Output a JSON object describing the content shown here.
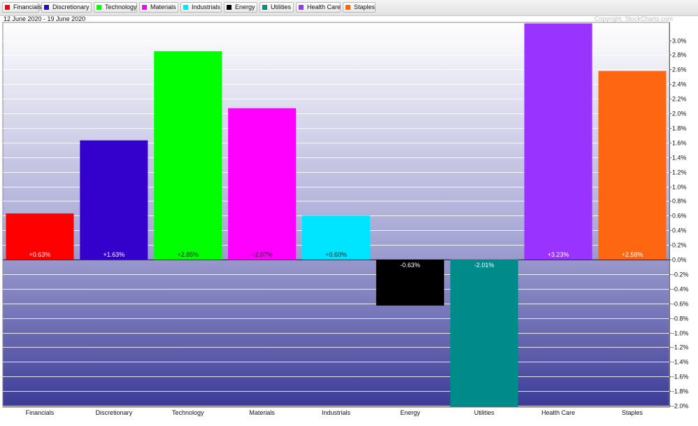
{
  "legend": [
    {
      "label": "Financials",
      "color": "#ff0000"
    },
    {
      "label": "Discretionary",
      "color": "#3300cc"
    },
    {
      "label": "Technology",
      "color": "#00ff00"
    },
    {
      "label": "Materials",
      "color": "#ff00ff"
    },
    {
      "label": "Industrials",
      "color": "#00e5ff"
    },
    {
      "label": "Energy",
      "color": "#000000"
    },
    {
      "label": "Utilities",
      "color": "#008b8b"
    },
    {
      "label": "Health Care",
      "color": "#9933ff"
    },
    {
      "label": "Staples",
      "color": "#ff6611"
    }
  ],
  "date_range": "12 June 2020 - 19 June 2020",
  "copyright": "Copyright, StockCharts.com",
  "chart_data": {
    "type": "bar",
    "categories": [
      "Financials",
      "Discretionary",
      "Technology",
      "Materials",
      "Industrials",
      "Energy",
      "Utilities",
      "Health Care",
      "Staples"
    ],
    "values": [
      0.63,
      1.63,
      2.85,
      2.07,
      0.6,
      -0.63,
      -2.01,
      3.23,
      2.58
    ],
    "value_labels": [
      "+0.63%",
      "+1.63%",
      "+2.85%",
      "+2.07%",
      "+0.60%",
      "-0.63%",
      "-2.01%",
      "+3.23%",
      "+2.58%"
    ],
    "colors": [
      "#ff0000",
      "#3300cc",
      "#00ff00",
      "#ff00ff",
      "#00e5ff",
      "#000000",
      "#008b8b",
      "#9933ff",
      "#ff6611"
    ],
    "label_colors": [
      "#ffffff",
      "#ffffff",
      "#222222",
      "#222222",
      "#222222",
      "#ffffff",
      "#ffffff",
      "#ffffff",
      "#ffffff"
    ],
    "yticks": [
      3.0,
      2.8,
      2.6,
      2.4,
      2.2,
      2.0,
      1.8,
      1.6,
      1.4,
      1.2,
      1.0,
      0.8,
      0.6,
      0.4,
      0.2,
      0.0,
      -0.2,
      -0.4,
      -0.6,
      -0.8,
      -1.0,
      -1.2,
      -1.4,
      -1.6,
      -1.8,
      -2.0
    ],
    "ytick_labels": [
      "3.0%",
      "2.8%",
      "2.6%",
      "2.4%",
      "2.2%",
      "2.0%",
      "1.8%",
      "1.6%",
      "1.4%",
      "1.2%",
      "1.0%",
      "0.8%",
      "0.6%",
      "0.4%",
      "0.2%",
      "0.0%",
      "-0.2%",
      "-0.4%",
      "-0.6%",
      "-0.8%",
      "-1.0%",
      "-1.2%",
      "-1.4%",
      "-1.6%",
      "-1.8%",
      "-2.0%"
    ],
    "ylim": [
      -2.02,
      3.23
    ],
    "grid": true,
    "y_axis_side": "right",
    "legend_position": "top"
  }
}
